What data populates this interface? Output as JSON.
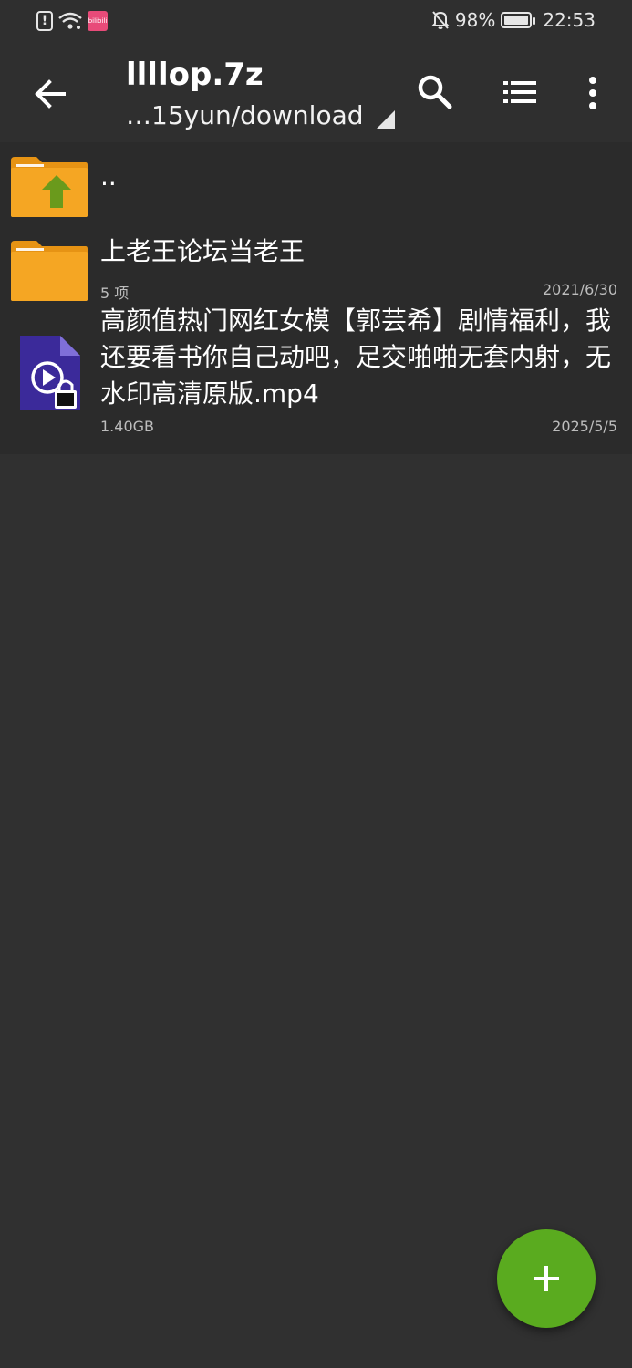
{
  "status_bar": {
    "app_badge_text": "bilibili",
    "battery_percent": "98%",
    "battery_level": 0.98,
    "time": "22:53"
  },
  "app_bar": {
    "title": "llllop.7z",
    "path": "…15yun/download"
  },
  "list": [
    {
      "type": "parent",
      "name": ".."
    },
    {
      "type": "folder",
      "name": "上老王论坛当老王",
      "meta": "5 项",
      "date": "2021/6/30"
    },
    {
      "type": "file",
      "name": "高颜值热门网红女模【郭芸希】剧情福利，我还要看书你自己动吧，足交啪啪无套内射，无水印高清原版.mp4",
      "size": "1.40GB",
      "date": "2025/5/5"
    }
  ],
  "colors": {
    "background": "#303030",
    "folder": "#f5a623",
    "up_arrow": "#6a9a1c",
    "video_icon": "#3b2a9a",
    "fab": "#5aab1f"
  },
  "icons": {
    "back": "arrow-left-icon",
    "search": "search-icon",
    "view": "list-view-icon",
    "more": "more-vertical-icon",
    "fab": "plus-icon"
  }
}
